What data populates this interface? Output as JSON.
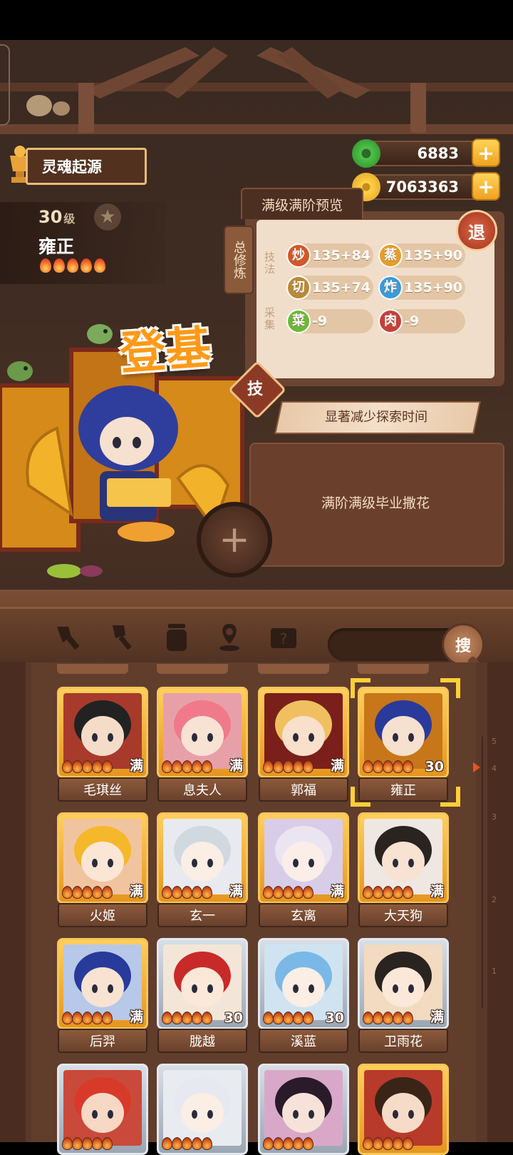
{
  "header": {
    "title": "灵魂起源"
  },
  "hero": {
    "level": "30",
    "level_unit": "级",
    "name": "雍正",
    "star_count": 5,
    "banner": "登基"
  },
  "currency": {
    "jade": "6883",
    "coins": "7063363"
  },
  "stats": {
    "tab_label": "满级满阶预览",
    "side_tag": "总修炼",
    "exit_label": "退",
    "section_skill": "技法",
    "section_gather": "采集",
    "items": [
      {
        "icon": "炒",
        "value": "135+84",
        "color": "#d2582b"
      },
      {
        "icon": "蒸",
        "value": "135+90",
        "color": "#e89c2a"
      },
      {
        "icon": "切",
        "value": "135+74",
        "color": "#b88a3a"
      },
      {
        "icon": "炸",
        "value": "135+90",
        "color": "#3a9ad8"
      },
      {
        "icon": "菜",
        "value": "-9",
        "color": "#6ab83a"
      },
      {
        "icon": "肉",
        "value": "-9",
        "color": "#c6403a"
      }
    ]
  },
  "skill": {
    "badge": "技",
    "description": "显著减少探索时间"
  },
  "note": {
    "text": "满阶满级毕业撒花"
  },
  "toolbar": {
    "search_label": "搜"
  },
  "roster": {
    "ruler_ticks": [
      "5",
      "4",
      "3",
      "2",
      "1"
    ],
    "cards": [
      {
        "name": "毛琪丝",
        "badge": "满",
        "tier": "gold",
        "bg": "#a83a2c",
        "skin": "#f4dcc8",
        "hair": "#222"
      },
      {
        "name": "息夫人",
        "badge": "满",
        "tier": "gold",
        "bg": "#e8a0a8",
        "skin": "#f8e2d4",
        "hair": "#f07a8a"
      },
      {
        "name": "郭福",
        "badge": "满",
        "tier": "gold",
        "bg": "#7a1f1a",
        "skin": "#f8e0cc",
        "hair": "#f0c060"
      },
      {
        "name": "雍正",
        "badge": "30",
        "tier": "gold",
        "bg": "#c7761a",
        "skin": "#f6e0d0",
        "hair": "#2a3a9a",
        "selected": true
      },
      {
        "name": "火姬",
        "badge": "满",
        "tier": "gold",
        "bg": "#f1c4a0",
        "skin": "#fbe6d6",
        "hair": "#f4b82a"
      },
      {
        "name": "玄一",
        "badge": "满",
        "tier": "gold",
        "bg": "#e8eaf0",
        "skin": "#fbeee4",
        "hair": "#d0d8e0"
      },
      {
        "name": "玄离",
        "badge": "满",
        "tier": "gold",
        "bg": "#d8cde8",
        "skin": "#fbeee8",
        "hair": "#ebe5f2"
      },
      {
        "name": "大天狗",
        "badge": "满",
        "tier": "gold",
        "bg": "#efe7e2",
        "skin": "#f8e2d2",
        "hair": "#2a2420"
      },
      {
        "name": "后羿",
        "badge": "满",
        "tier": "gold",
        "bg": "#b7c8e8",
        "skin": "#f8e2d2",
        "hair": "#283a9a"
      },
      {
        "name": "胧越",
        "badge": "30",
        "tier": "silver",
        "bg": "#f3e6d8",
        "skin": "#fbe8d8",
        "hair": "#c82a2a"
      },
      {
        "name": "溪蓝",
        "badge": "30",
        "tier": "silver",
        "bg": "#cfe4f0",
        "skin": "#fbeee4",
        "hair": "#7ab8e8"
      },
      {
        "name": "卫雨花",
        "badge": "满",
        "tier": "silver",
        "bg": "#f2dbc0",
        "skin": "#fbe8d8",
        "hair": "#2a2420"
      },
      {
        "name": "",
        "badge": "",
        "tier": "silver",
        "bg": "#c94a3a",
        "skin": "#f6d8c4",
        "hair": "#d83a2a"
      },
      {
        "name": "",
        "badge": "",
        "tier": "silver",
        "bg": "#e8ecf0",
        "skin": "#fbeee4",
        "hair": "#e8e8f0"
      },
      {
        "name": "",
        "badge": "",
        "tier": "silver",
        "bg": "#d9a8c8",
        "skin": "#f6e2d8",
        "hair": "#2a1a2a"
      },
      {
        "name": "",
        "badge": "",
        "tier": "gold",
        "bg": "#b83a2a",
        "skin": "#f6dcc8",
        "hair": "#3a2418"
      }
    ]
  }
}
